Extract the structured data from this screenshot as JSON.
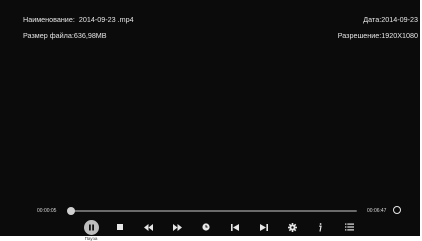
{
  "info": {
    "name_label": "Наименование:",
    "name_value": "2014-09-23 .mp4",
    "size_label": "Размер файла:",
    "size_value": "636,98MB",
    "date_label": "Дата:",
    "date_value": "2014-09-23",
    "resolution_label": "Разрешение:",
    "resolution_value": "1920X1080"
  },
  "playback": {
    "current_time": "00:00:05",
    "duration": "00:06:47",
    "progress": 0.012
  },
  "controls": {
    "pause_label": "Пауза",
    "buttons": [
      {
        "name": "pause-icon"
      },
      {
        "name": "stop-icon"
      },
      {
        "name": "rewind-icon"
      },
      {
        "name": "fast-forward-icon"
      },
      {
        "name": "clock-icon"
      },
      {
        "name": "previous-icon"
      },
      {
        "name": "next-icon"
      },
      {
        "name": "settings-icon"
      },
      {
        "name": "info-icon"
      },
      {
        "name": "playlist-icon"
      },
      {
        "name": "loop-icon"
      }
    ]
  },
  "colors": {
    "background": "#0b0b0b",
    "text": "#e6e6e6",
    "track": "#6a6a6a",
    "track_fill": "#cfcfcf",
    "active_button": "#bdbdbd"
  }
}
